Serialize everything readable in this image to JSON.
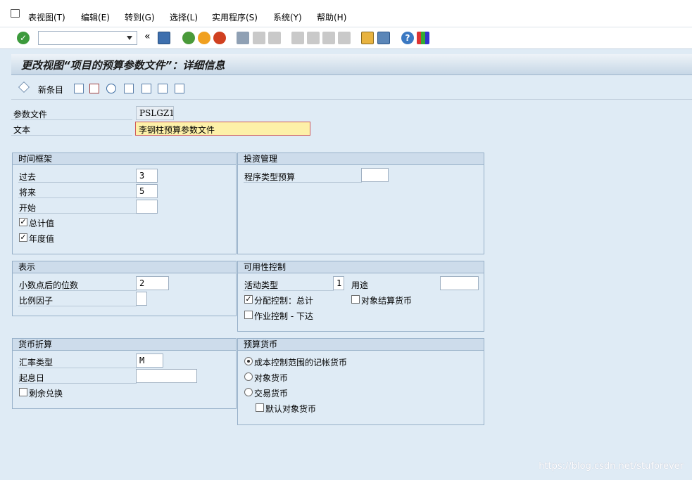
{
  "menu": {
    "items": [
      "表视图(T)",
      "编辑(E)",
      "转到(G)",
      "选择(L)",
      "实用程序(S)",
      "系统(Y)",
      "帮助(H)"
    ]
  },
  "toolbar": {
    "command_field_value": "",
    "back_chevrons": "«",
    "icons": [
      "check-icon",
      "save-icon",
      "back-icon",
      "exit-icon",
      "cancel-icon",
      "print-icon",
      "find-icon",
      "find-next-icon",
      "first-page-icon",
      "previous-page-icon",
      "next-page-icon",
      "last-page-icon",
      "create-session-icon",
      "shortcut-icon",
      "help-icon",
      "customize-layout-icon"
    ]
  },
  "title": "更改视图“项目的预算参数文件”：详细信息",
  "app_toolbar": {
    "new_entries_label": "新条目"
  },
  "header_fields": {
    "profile_label": "参数文件",
    "profile_value": "PSLGZ1",
    "text_label": "文本",
    "text_value": "李钢柱预算参数文件"
  },
  "time_frame": {
    "title": "时间框架",
    "past_label": "过去",
    "past_value": "3",
    "future_label": "将来",
    "future_value": "5",
    "start_label": "开始",
    "start_value": "",
    "total_label": "总计值",
    "total_checked": "✓",
    "annual_label": "年度值",
    "annual_checked": "✓"
  },
  "investment": {
    "title": "投资管理",
    "program_label": "程序类型预算",
    "program_value": ""
  },
  "representation": {
    "title": "表示",
    "decimals_label": "小数点后的位数",
    "decimals_value": "2",
    "scaling_label": "比例因子",
    "scaling_value": ""
  },
  "availability": {
    "title": "可用性控制",
    "activity_label": "活动类型",
    "activity_value": "1",
    "usage_label": "用途",
    "usage_value": "",
    "distribution_label": "分配控制：总计",
    "distribution_checked": "✓",
    "object_currency_label": "对象结算货币",
    "release_label": "作业控制 - 下达"
  },
  "currency_translation": {
    "title": "货币折算",
    "rate_label": "汇率类型",
    "rate_value": "M",
    "value_date_label": "起息日",
    "value_date_value": "",
    "remainder_label": "剩余兑换"
  },
  "budget_currency": {
    "title": "预算货币",
    "co_area_label": "成本控制范围的记帐货币",
    "object_label": "对象货币",
    "transaction_label": "交易货币",
    "default_object_label": "默认对象货币"
  },
  "watermark": "https://blog.csdn.net/stuforever",
  "colors": {
    "background": "#dfebf5",
    "group_header": "#cddceb",
    "focus_field": "#fdf0a8",
    "ok_green": "#3c9a3c"
  }
}
